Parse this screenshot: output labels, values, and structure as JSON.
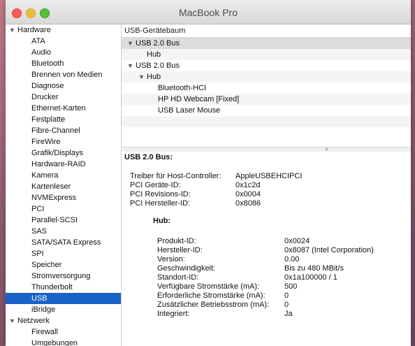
{
  "window": {
    "title": "MacBook Pro"
  },
  "sidebar": {
    "hardware_label": "Hardware",
    "hardware_items": [
      "ATA",
      "Audio",
      "Bluetooth",
      "Brennen von Medien",
      "Diagnose",
      "Drucker",
      "Ethernet-Karten",
      "Festplatte",
      "Fibre-Channel",
      "FireWire",
      "Grafik/Displays",
      "Hardware-RAID",
      "Kamera",
      "Kartenleser",
      "NVMExpress",
      "PCI",
      "Parallel-SCSI",
      "SAS",
      "SATA/SATA Express",
      "SPI",
      "Speicher",
      "Stromversorgung",
      "Thunderbolt",
      "USB",
      "iBridge"
    ],
    "selected_item": "USB",
    "network_label": "Netzwerk",
    "network_items": [
      "Firewall",
      "Umgebungen"
    ]
  },
  "tree": {
    "header": "USB-Gerätebaum",
    "rows": [
      {
        "label": "USB 2.0 Bus",
        "indent": 0,
        "disclosure": "▼",
        "selected": true
      },
      {
        "label": "Hub",
        "indent": 1,
        "disclosure": "",
        "selected": false
      },
      {
        "label": "USB 2.0 Bus",
        "indent": 0,
        "disclosure": "▼",
        "selected": false
      },
      {
        "label": "Hub",
        "indent": 1,
        "disclosure": "▼",
        "selected": false
      },
      {
        "label": "Bluetooth-HCI",
        "indent": 2,
        "disclosure": "",
        "selected": false
      },
      {
        "label": "HP HD Webcam [Fixed]",
        "indent": 2,
        "disclosure": "",
        "selected": false
      },
      {
        "label": "USB Laser Mouse",
        "indent": 2,
        "disclosure": "",
        "selected": false
      }
    ]
  },
  "detail": {
    "title": "USB 2.0 Bus:",
    "bus_props": [
      {
        "key": "Treiber für Host-Controller:",
        "value": "AppleUSBEHCIPCI"
      },
      {
        "key": "PCI Geräte-ID:",
        "value": "0x1c2d"
      },
      {
        "key": "PCI Revisions-ID:",
        "value": "0x0004"
      },
      {
        "key": "PCI Hersteller-ID:",
        "value": "0x8086"
      }
    ],
    "hub_title": "Hub:",
    "hub_props": [
      {
        "key": "Produkt-ID:",
        "value": "0x0024"
      },
      {
        "key": "Hersteller-ID:",
        "value": "0x8087  (Intel Corporation)"
      },
      {
        "key": "Version:",
        "value": "0.00"
      },
      {
        "key": "Geschwindigkeit:",
        "value": "Bis zu 480 MBit/s"
      },
      {
        "key": "Standort-ID:",
        "value": "0x1a100000 / 1"
      },
      {
        "key": "Verfügbare Stromstärke (mA):",
        "value": "500"
      },
      {
        "key": "Erforderliche Stromstärke (mA):",
        "value": "0"
      },
      {
        "key": "Zusätzlicher Betriebsstrom (mA):",
        "value": "0"
      },
      {
        "key": "Integriert:",
        "value": "Ja"
      }
    ]
  }
}
